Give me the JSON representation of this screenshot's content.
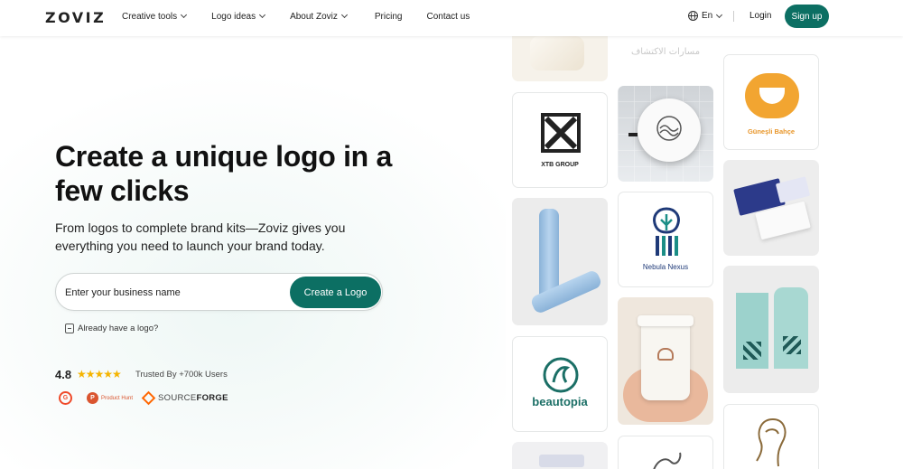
{
  "header": {
    "logo_text": "ZOVIZ",
    "nav": [
      {
        "label": "Creative tools",
        "dropdown": true
      },
      {
        "label": "Logo ideas",
        "dropdown": true
      },
      {
        "label": "About Zoviz",
        "dropdown": true
      },
      {
        "label": "Pricing",
        "dropdown": false
      },
      {
        "label": "Contact us",
        "dropdown": false
      }
    ],
    "language": "En",
    "login_label": "Login",
    "signup_label": "Sign up"
  },
  "hero": {
    "title": "Create a unique logo in a few clicks",
    "subtitle": "From logos to complete brand kits—Zoviz gives you everything you need to launch your brand today.",
    "input_placeholder": "Enter your business name",
    "cta_label": "Create a Logo",
    "have_logo_label": "Already have a logo?",
    "rating": "4.8",
    "stars": "★★★★★",
    "trusted_text": "Trusted By +700k Users",
    "badges": {
      "g2": "G",
      "producthunt_icon": "P",
      "producthunt_text": "Product Hunt",
      "sourceforge_prefix": "SOURCE",
      "sourceforge_suffix": "FORGE"
    }
  },
  "gallery": {
    "arabic_text": "مسارات الاكتشاف",
    "xtb_label": "XTB GROUP",
    "nebula_label": "Nebula Nexus",
    "gunesli_label": "Güneşli Bahçe",
    "beautopia_label": "beautopia",
    "colors": {
      "brand": "#0c6f63",
      "teal_dark": "#1b6f66",
      "navy": "#1f3a78",
      "bottle": "#9ec3e6",
      "cafe_orange": "#f2a531"
    }
  }
}
